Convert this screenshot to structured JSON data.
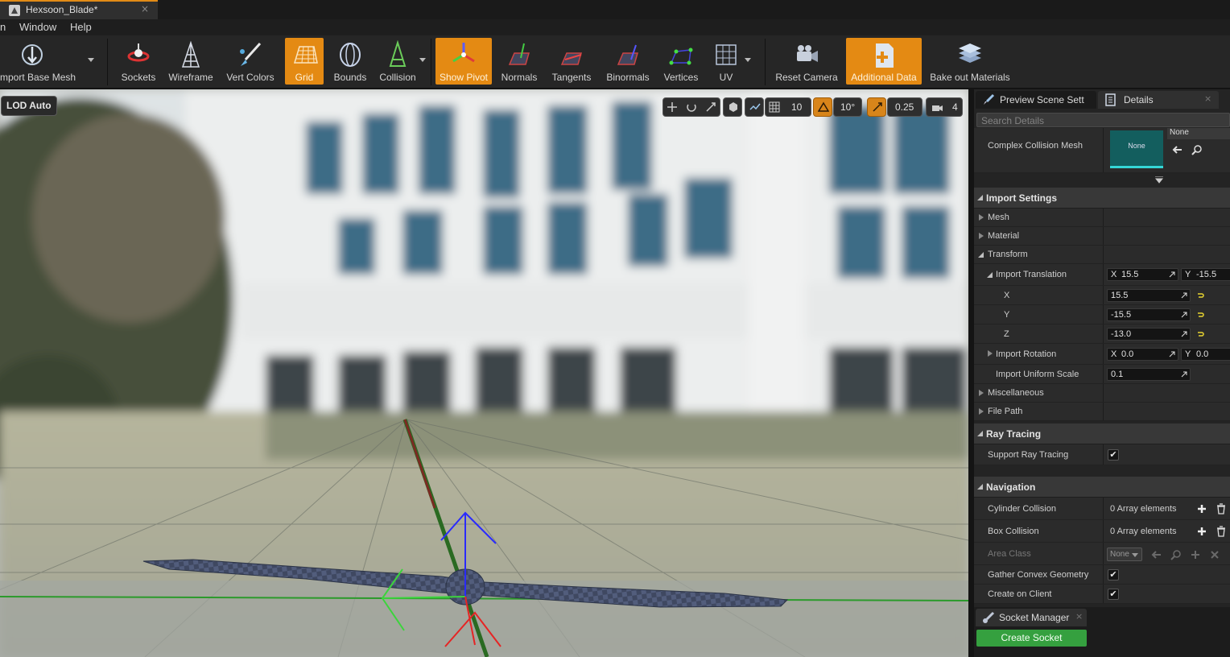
{
  "window": {
    "tab_title": "Hexsoon_Blade*",
    "tab_close": "×"
  },
  "menubar": {
    "items": [
      "n",
      "Window",
      "Help"
    ]
  },
  "toolbar": {
    "import_base_mesh": "mport Base Mesh",
    "sockets": "Sockets",
    "wireframe": "Wireframe",
    "vert_colors": "Vert Colors",
    "grid": "Grid",
    "bounds": "Bounds",
    "collision": "Collision",
    "show_pivot": "Show Pivot",
    "normals": "Normals",
    "tangents": "Tangents",
    "binormals": "Binormals",
    "vertices": "Vertices",
    "uv": "UV",
    "reset_camera": "Reset Camera",
    "additional_data": "Additional Data",
    "bake_out_materials": "Bake out Materials",
    "active_color": "#e48a13"
  },
  "viewport": {
    "lod_label": "LOD Auto",
    "grid_snap": "10",
    "rotation_snap": "10°",
    "scale_snap": "0.25",
    "camera_speed": "4"
  },
  "panel_tabs": {
    "preview_scene": "Preview Scene Sett",
    "details": "Details",
    "close": "×"
  },
  "search": {
    "placeholder": "Search Details"
  },
  "complex_collision": {
    "label": "Complex Collision Mesh",
    "thumb_text": "None",
    "value": "None"
  },
  "import_settings": {
    "header": "Import Settings",
    "mesh": "Mesh",
    "material": "Material",
    "transform": "Transform",
    "import_translation": {
      "label": "Import Translation",
      "x_axis": "X",
      "x_value": "15.5",
      "y_axis": "Y",
      "y_value": "-15.5",
      "x_label": "X",
      "y_label": "Y",
      "z_label": "Z",
      "x": "15.5",
      "y": "-15.5",
      "z": "-13.0"
    },
    "import_rotation": {
      "label": "Import Rotation",
      "x_axis": "X",
      "x_value": "0.0",
      "y_axis": "Y",
      "y_value": "0.0"
    },
    "uniform_scale": {
      "label": "Import Uniform Scale",
      "value": "0.1"
    },
    "miscellaneous": "Miscellaneous",
    "file_path": "File Path"
  },
  "ray_tracing": {
    "header": "Ray Tracing",
    "support_label": "Support Ray Tracing",
    "support_checked": true
  },
  "navigation": {
    "header": "Navigation",
    "cylinder_label": "Cylinder Collision",
    "cylinder_value": "0 Array elements",
    "box_label": "Box Collision",
    "box_value": "0 Array elements",
    "area_class_label": "Area Class",
    "area_class_value": "None",
    "gather_convex_label": "Gather Convex Geometry",
    "gather_convex_checked": true,
    "create_on_client_label": "Create on Client",
    "create_on_client_checked": true
  },
  "socket_manager": {
    "title": "Socket Manager",
    "close": "×",
    "create_button": "Create Socket",
    "button_color": "#35a03f"
  }
}
